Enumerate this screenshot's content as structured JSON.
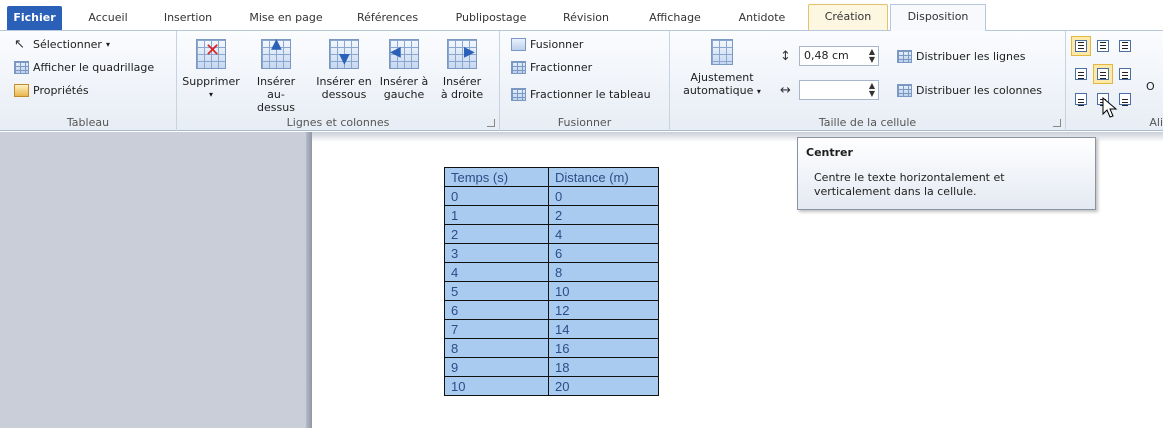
{
  "tabs": [
    {
      "label": "Fichier"
    },
    {
      "label": "Accueil"
    },
    {
      "label": "Insertion"
    },
    {
      "label": "Mise en page"
    },
    {
      "label": "Références"
    },
    {
      "label": "Publipostage"
    },
    {
      "label": "Révision"
    },
    {
      "label": "Affichage"
    },
    {
      "label": "Antidote"
    },
    {
      "label": "Création"
    },
    {
      "label": "Disposition"
    }
  ],
  "ribbon": {
    "tableau": {
      "select": "Sélectionner",
      "grid": "Afficher le quadrillage",
      "properties": "Propriétés",
      "group_label": "Tableau"
    },
    "lignes": {
      "delete": "Supprimer",
      "insert_above_1": "Insérer",
      "insert_above_2": "au-dessus",
      "insert_below_1": "Insérer en",
      "insert_below_2": "dessous",
      "insert_left_1": "Insérer à",
      "insert_left_2": "gauche",
      "insert_right_1": "Insérer",
      "insert_right_2": "à droite",
      "group_label": "Lignes et colonnes"
    },
    "fusionner": {
      "merge": "Fusionner",
      "split": "Fractionner",
      "split_table": "Fractionner le tableau",
      "group_label": "Fusionner"
    },
    "taille": {
      "autofit_1": "Ajustement",
      "autofit_2": "automatique",
      "height_value": "0,48 cm",
      "width_value": "",
      "distribute_rows": "Distribuer les lignes",
      "distribute_cols": "Distribuer les colonnes",
      "group_label": "Taille de la cellule"
    },
    "alignment": {
      "group_label": "Ali",
      "extra": "O"
    }
  },
  "table": {
    "headers": [
      "Temps (s)",
      "Distance (m)"
    ],
    "rows": [
      [
        "0",
        "0"
      ],
      [
        "1",
        "2"
      ],
      [
        "2",
        "4"
      ],
      [
        "3",
        "6"
      ],
      [
        "4",
        "8"
      ],
      [
        "5",
        "10"
      ],
      [
        "6",
        "12"
      ],
      [
        "7",
        "14"
      ],
      [
        "8",
        "16"
      ],
      [
        "9",
        "18"
      ],
      [
        "10",
        "20"
      ]
    ]
  },
  "tooltip": {
    "title": "Centrer",
    "body_1": "Centre le texte horizontalement et",
    "body_2": "verticalement dans la cellule."
  },
  "colors": {
    "file_tab": "#2a60b8",
    "cell_fill": "#a9cbef",
    "cell_text": "#2b4e87"
  }
}
